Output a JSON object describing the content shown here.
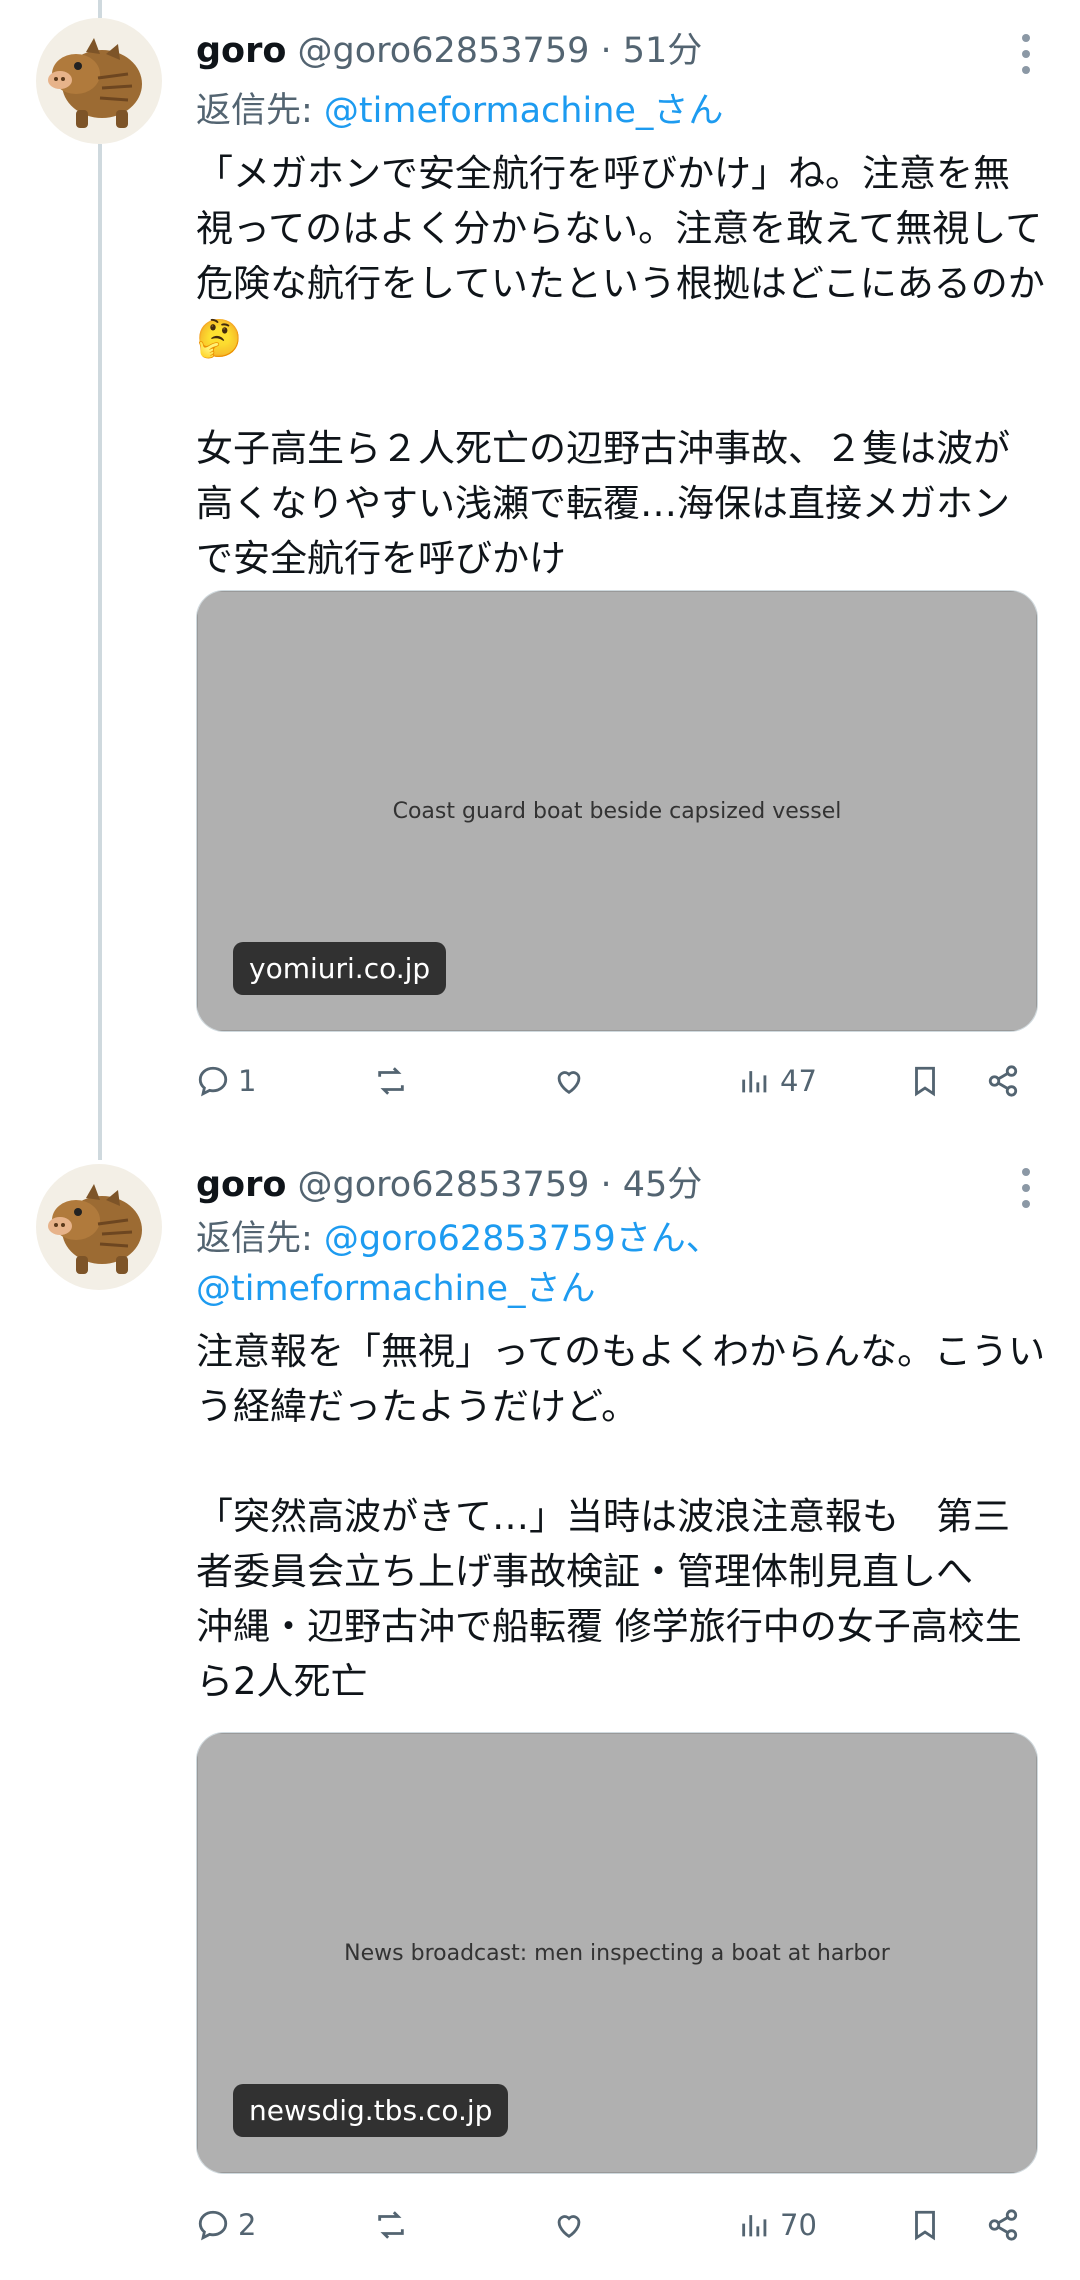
{
  "tweets": [
    {
      "name": "goro",
      "handle": "@goro62853759",
      "time": " · 51分",
      "reply_label": "返信先: ",
      "reply_link": "@timeformachine_さん",
      "paragraph1": "「メガホンで安全航行を呼びかけ」ね。注意を無視ってのはよく分からない。注意を敢えて無視して危険な航行をしていたという根拠はどこにあるのか🤔",
      "paragraph2": "女子高生ら２人死亡の辺野古沖事故、２隻は波が高くなりやすい浅瀬で転覆…海保は直接メガホンで安全航行を呼びかけ",
      "media_domain": "yomiuri.co.jp",
      "media_label": "Coast guard boat beside capsized vessel",
      "replies": "1",
      "reposts": "",
      "likes": "",
      "views": "47"
    },
    {
      "name": "goro",
      "handle": "@goro62853759",
      "time": " · 45分",
      "reply_label": "返信先: ",
      "reply_link": "@goro62853759さん、",
      "reply_link2": "@timeformachine_さん",
      "paragraph1": "注意報を「無視」ってのもよくわからんな。こういう経緯だったようだけど。",
      "paragraph2": "「突然高波がきて…」当時は波浪注意報も　第三者委員会立ち上げ事故検証・管理体制見直しへ　沖縄・辺野古沖で船転覆 修学旅行中の女子高校生ら2人死亡",
      "media_domain": "newsdig.tbs.co.jp",
      "media_label": "News broadcast: men inspecting a boat at harbor",
      "replies": "2",
      "reposts": "",
      "likes": "",
      "views": "70"
    }
  ],
  "icons": [
    "reply-icon",
    "repost-icon",
    "like-icon",
    "views-icon",
    "bookmark-icon",
    "share-icon",
    "more-icon",
    "avatar-boar"
  ],
  "colors": {
    "link": "#1d9bf0",
    "secondary": "#536471",
    "text": "#0f1419"
  }
}
